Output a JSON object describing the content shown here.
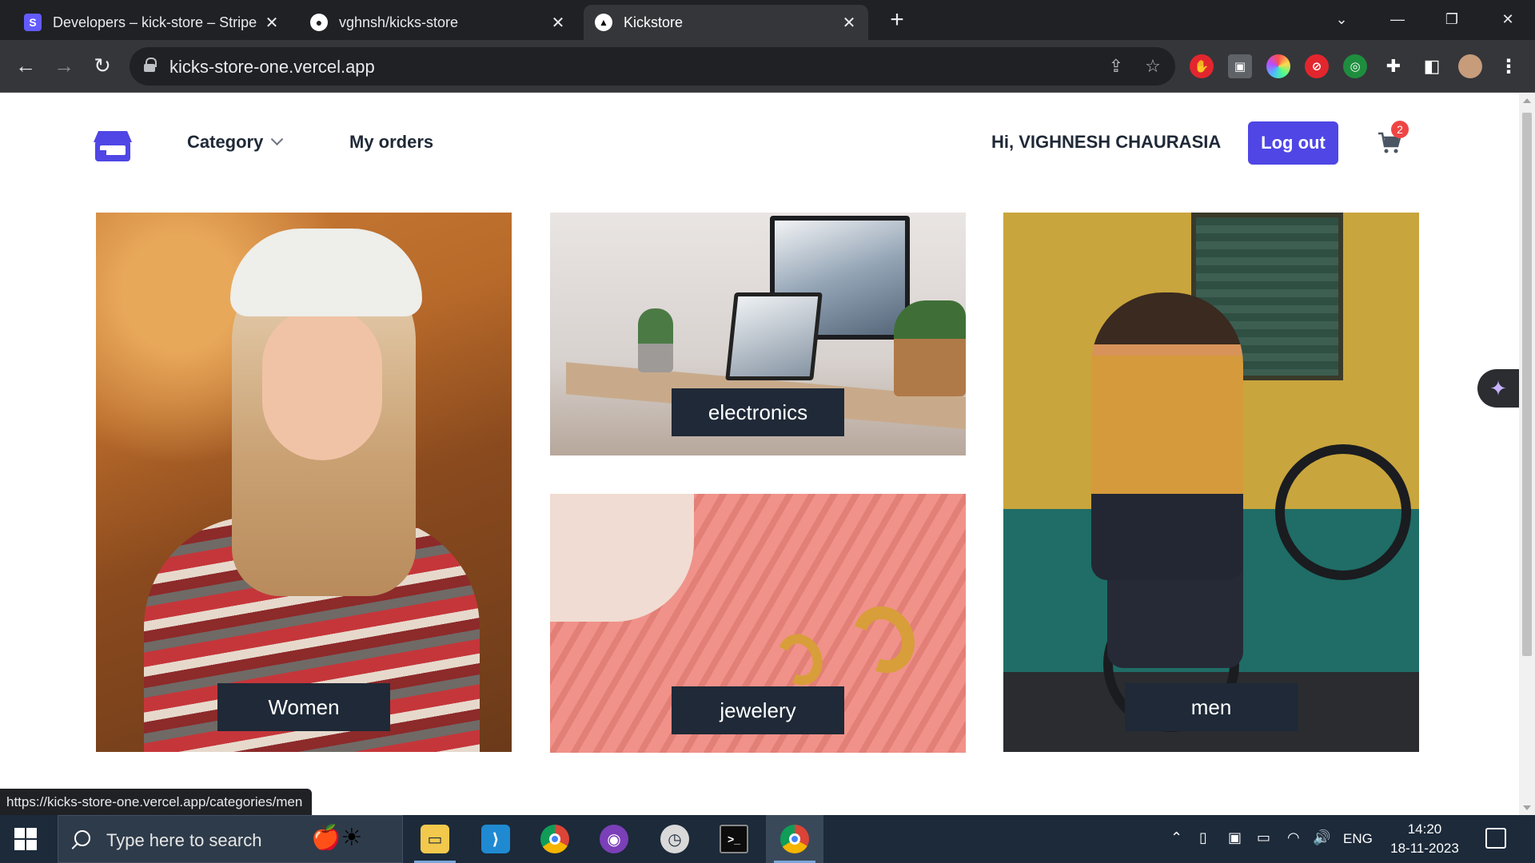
{
  "browser": {
    "tabs": [
      {
        "title": "Developers – kick-store – Stripe",
        "favicon": "stripe-icon",
        "active": false
      },
      {
        "title": "vghnsh/kicks-store",
        "favicon": "github-icon",
        "active": false
      },
      {
        "title": "Kickstore",
        "favicon": "vercel-icon",
        "active": true
      }
    ],
    "url": "kicks-store-one.vercel.app",
    "status_url": "https://kicks-store-one.vercel.app/categories/men"
  },
  "header": {
    "nav": {
      "category_label": "Category",
      "orders_label": "My orders"
    },
    "greeting": "Hi, VIGHNESH CHAURASIA",
    "logout_label": "Log out",
    "cart_count": "2"
  },
  "categories": [
    {
      "label": "Women"
    },
    {
      "label": "electronics"
    },
    {
      "label": "jewelery"
    },
    {
      "label": "men"
    }
  ],
  "taskbar": {
    "search_placeholder": "Type here to search",
    "language": "ENG",
    "time": "14:20",
    "date": "18-11-2023"
  },
  "colors": {
    "accent": "#4f46e5",
    "caption_bg": "#1f2937",
    "badge": "#ef4444"
  }
}
